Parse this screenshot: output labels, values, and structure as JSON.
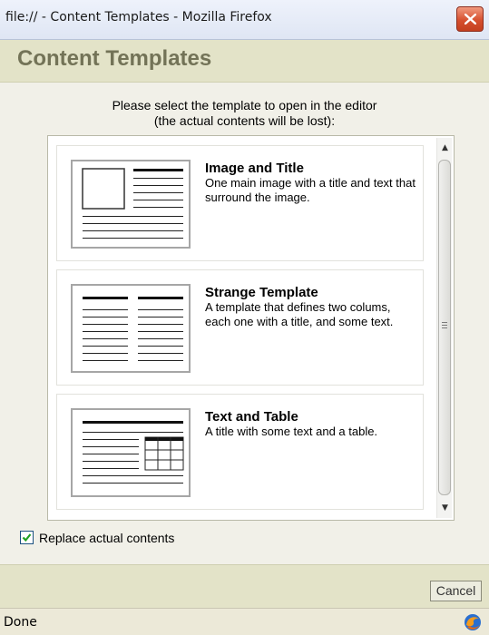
{
  "window": {
    "title": "file:// - Content Templates - Mozilla Firefox",
    "close_glyph": "close-icon"
  },
  "dialog": {
    "heading": "Content Templates",
    "instructions_line1": "Please select the template to open in the editor",
    "instructions_line2": "(the actual contents will be lost):",
    "templates": [
      {
        "title": "Image and Title",
        "description": "One main image with a title and text that surround the image.",
        "thumbnail_icon": "image-and-title-thumbnail-icon"
      },
      {
        "title": "Strange Template",
        "description": "A template that defines two colums, each one with a title, and some text.",
        "thumbnail_icon": "two-column-thumbnail-icon"
      },
      {
        "title": "Text and Table",
        "description": "A title with some text and a table.",
        "thumbnail_icon": "text-and-table-thumbnail-icon"
      }
    ],
    "replace_contents_label": "Replace actual contents",
    "replace_contents_checked": true,
    "cancel_label": "Cancel"
  },
  "statusbar": {
    "text": "Done",
    "icon": "firefox-status-icon"
  },
  "colors": {
    "header_bg": "#e3e3c8",
    "heading_text": "#737357",
    "dialog_bg": "#f1f0e8",
    "close_button": "#d6502f"
  }
}
